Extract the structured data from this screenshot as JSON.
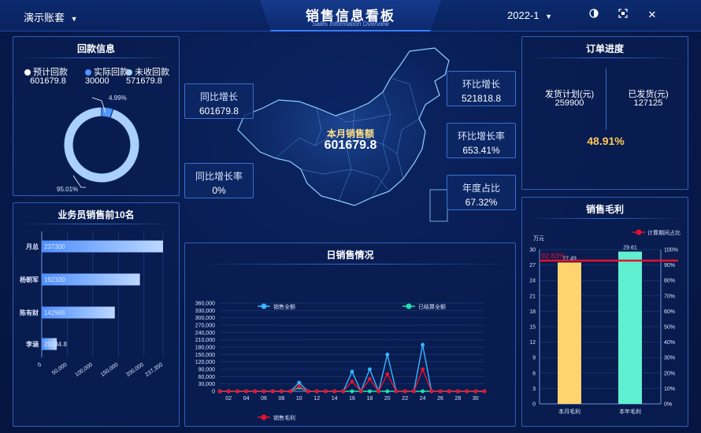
{
  "header": {
    "account_label": "演示账套",
    "title": "销售信息看板",
    "subtitle": "Sales Information Overview",
    "period": "2022-1",
    "icons": [
      "theme-icon",
      "fullscreen-icon",
      "close-icon"
    ]
  },
  "payback": {
    "title": "回款信息",
    "legend": [
      {
        "label": "预计回款",
        "value": "601679.8",
        "color": "#ffffff"
      },
      {
        "label": "实际回款",
        "value": "30000",
        "color": "#4f95ff"
      },
      {
        "label": "未收回款",
        "value": "571679.8",
        "color": "#a9d0ff"
      }
    ],
    "donut": {
      "slices": [
        {
          "name": "实际回款",
          "percent": 4.99,
          "label": "4.99%",
          "color": "#4f95ff"
        },
        {
          "name": "未收回款",
          "percent": 95.01,
          "label": "95.01%",
          "color": "#a9d0ff"
        }
      ]
    }
  },
  "salesmen": {
    "title": "业务员销售前10名",
    "chart_data": {
      "type": "bar",
      "orientation": "horizontal",
      "categories": [
        "月总",
        "杨朝军",
        "陈有财",
        "李涵"
      ],
      "values": [
        237300,
        192100,
        142945,
        29334.8
      ],
      "value_labels": [
        "237300",
        "192100",
        "142945",
        "29334.8"
      ],
      "x_ticks": [
        "0",
        "50,000",
        "100,000",
        "150,000",
        "200,000",
        "237,350"
      ],
      "xlim": [
        0,
        237350
      ]
    }
  },
  "map": {
    "center_label": "本月销售额",
    "center_value": "601679.8",
    "callouts": [
      {
        "label": "同比增长",
        "value": "601679.8"
      },
      {
        "label": "同比增长率",
        "value": "0%"
      },
      {
        "label": "环比增长",
        "value": "521818.8"
      },
      {
        "label": "环比增长率",
        "value": "653.41%"
      },
      {
        "label": "年度占比",
        "value": "67.32%"
      }
    ]
  },
  "daily": {
    "title": "日销售情况",
    "chart_data": {
      "type": "line",
      "x": [
        1,
        2,
        3,
        4,
        5,
        6,
        7,
        8,
        9,
        10,
        11,
        12,
        13,
        14,
        15,
        16,
        17,
        18,
        19,
        20,
        21,
        22,
        23,
        24,
        25,
        26,
        27,
        28,
        29,
        30,
        31
      ],
      "x_ticks": [
        "02",
        "04",
        "06",
        "08",
        "10",
        "12",
        "14",
        "16",
        "18",
        "20",
        "22",
        "24",
        "26",
        "28",
        "30"
      ],
      "y_ticks": [
        "0",
        "30,000",
        "60,000",
        "90,000",
        "120,000",
        "150,000",
        "180,000",
        "210,000",
        "240,000",
        "270,000",
        "300,000",
        "330,000",
        "360,000"
      ],
      "ylim": [
        0,
        360000
      ],
      "series": [
        {
          "name": "销售全额",
          "color": "#35b8ff",
          "values": [
            0,
            0,
            0,
            0,
            0,
            0,
            0,
            0,
            0,
            35000,
            0,
            0,
            0,
            0,
            0,
            80000,
            0,
            90000,
            0,
            150000,
            0,
            0,
            0,
            190000,
            0,
            0,
            0,
            0,
            0,
            0,
            0
          ]
        },
        {
          "name": "已结算全额",
          "color": "#21e0b0",
          "values": [
            0,
            0,
            0,
            0,
            0,
            0,
            0,
            0,
            0,
            15000,
            0,
            0,
            0,
            0,
            0,
            0,
            0,
            0,
            0,
            0,
            0,
            0,
            0,
            0,
            0,
            0,
            0,
            0,
            0,
            0,
            0
          ]
        },
        {
          "name": "销售毛利",
          "color": "#e8112d",
          "values": [
            0,
            0,
            0,
            0,
            0,
            0,
            0,
            0,
            0,
            20000,
            0,
            0,
            0,
            0,
            0,
            40000,
            0,
            50000,
            0,
            70000,
            0,
            0,
            0,
            90000,
            0,
            0,
            0,
            0,
            0,
            0,
            0
          ]
        }
      ]
    }
  },
  "order": {
    "title": "订单进度",
    "plan_label": "发货计划(元)",
    "plan_value": "259900",
    "shipped_label": "已发货(元)",
    "shipped_value": "127125",
    "percent": "48.91%"
  },
  "margin": {
    "title": "销售毛利",
    "chart_data": {
      "type": "bar",
      "categories": [
        "本月毛利",
        "本年毛利"
      ],
      "values": [
        27.49,
        29.61
      ],
      "value_labels": [
        "27.49",
        "29.61"
      ],
      "colors": [
        "#ffd36e",
        "#5ef0d0"
      ],
      "ylabel": "万元",
      "ylim": [
        0,
        30
      ],
      "y_ticks": [
        "0",
        "3",
        "6",
        "9",
        "12",
        "15",
        "18",
        "21",
        "24",
        "27",
        "30"
      ],
      "y2_ticks": [
        "0%",
        "10%",
        "20%",
        "30%",
        "40%",
        "50%",
        "60%",
        "70%",
        "80%",
        "90%",
        "100%"
      ],
      "line": {
        "name": "计算期间占比",
        "value": 92.83,
        "label": "92.83%",
        "color": "#e8112d"
      }
    }
  }
}
